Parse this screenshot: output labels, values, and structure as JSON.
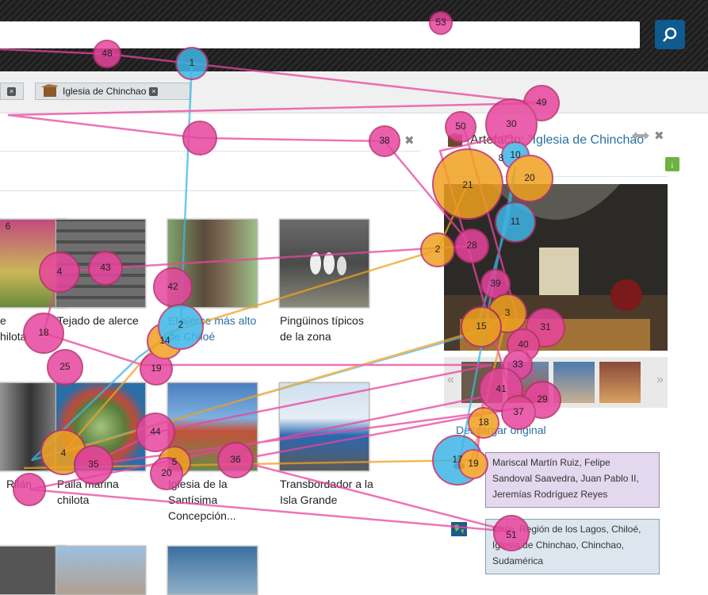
{
  "header": {
    "search_placeholder": ""
  },
  "breadcrumb": {
    "current": "Iglesia de Chinchao"
  },
  "closed_panel": {
    "close_symbol": "✖"
  },
  "artifact": {
    "prefix": "Artefacto: ",
    "title": "\"Iglesia de Chinchao\""
  },
  "grid": {
    "row1": [
      "e\nhilota",
      "Tejado de alerce",
      "El alerce más alto\nde Chiloé",
      "Pingüinos típicos\nde la zona"
    ],
    "row2": [
      "Rilán",
      "Paila marina\nchilota",
      "Iglesia de la\nSantísima\nConcepción...",
      "Transbordador a la\nIsla Grande"
    ]
  },
  "download_label": "Descargar original",
  "people_tags": "Mariscal Martín Ruiz, Felipe Sandoval Saavedra, Juan Pablo II, Jeremías Rodríguez Reyes",
  "place_tags": "Chile, Región de los Lagos, Chiloé, Iglesia de Chinchao, Chinchao, Sudamérica",
  "colors": {
    "pink": "#e8459e",
    "blue": "#3fb6e6",
    "orange": "#f0a11f",
    "search_button": "#0f5a8f"
  },
  "fixation_labels": [
    "53",
    "48",
    "1",
    "49",
    "50",
    "30",
    "38",
    "10",
    "21",
    "20",
    "11",
    "28",
    "2",
    "39",
    "42",
    "43",
    "4",
    "18",
    "25",
    "19",
    "14",
    "3",
    "15",
    "31",
    "40",
    "33",
    "41",
    "29",
    "37",
    "18",
    "44",
    "4",
    "35",
    "5",
    "20",
    "36",
    "17",
    "19",
    "51",
    "8",
    "6",
    "2"
  ]
}
